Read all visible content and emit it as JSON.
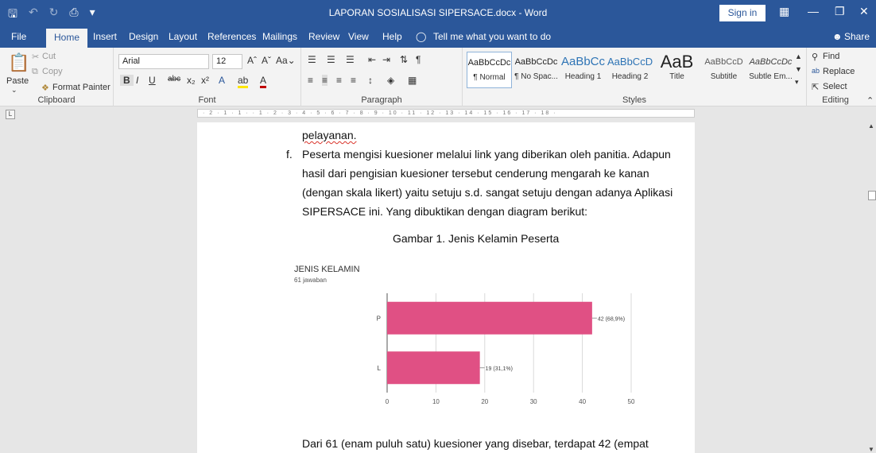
{
  "window": {
    "title": "LAPORAN SOSIALISASI SIPERSACE.docx  -  Word",
    "sign_in": "Sign in",
    "share": "Share"
  },
  "menu": {
    "tabs": [
      "File",
      "Home",
      "Insert",
      "Design",
      "Layout",
      "References",
      "Mailings",
      "Review",
      "View",
      "Help"
    ],
    "tell_me": "Tell me what you want to do"
  },
  "ribbon": {
    "clipboard": {
      "label": "Clipboard",
      "paste": "Paste",
      "cut": "Cut",
      "copy": "Copy",
      "format_painter": "Format Painter"
    },
    "font": {
      "label": "Font",
      "family": "Arial",
      "size": "12"
    },
    "paragraph": {
      "label": "Paragraph"
    },
    "styles": {
      "label": "Styles",
      "items": [
        {
          "preview": "AaBbCcDc",
          "name": "¶ Normal"
        },
        {
          "preview": "AaBbCcDc",
          "name": "¶ No Spac..."
        },
        {
          "preview": "AaBbCc",
          "name": "Heading 1"
        },
        {
          "preview": "AaBbCcD",
          "name": "Heading 2"
        },
        {
          "preview": "AaB",
          "name": "Title"
        },
        {
          "preview": "AaBbCcD",
          "name": "Subtitle"
        },
        {
          "preview": "AaBbCcDc",
          "name": "Subtle Em..."
        }
      ]
    },
    "editing": {
      "label": "Editing",
      "find": "Find",
      "replace": "Replace",
      "select": "Select"
    }
  },
  "document": {
    "line0": "pelayanan.",
    "item_marker": "f.",
    "para_lines": [
      "Peserta mengisi kuesioner melalui link yang diberikan oleh panitia. Adapun",
      "hasil dari pengisian kuesioner tersebut cenderung mengarah ke kanan",
      "(dengan skala likert) yaitu setuju s.d. sangat setuju dengan adanya Aplikasi",
      "SIPERSACE ini. Yang dibuktikan dengan diagram berikut:"
    ],
    "caption": "Gambar 1. Jenis Kelamin Peserta",
    "bottom_line": "Dari 61 (enam puluh satu) kuesioner yang disebar, terdapat 42 (empat"
  },
  "chart_data": {
    "type": "bar",
    "orientation": "horizontal",
    "title": "JENIS KELAMIN",
    "subtitle": "61 jawaban",
    "categories": [
      "P",
      "L"
    ],
    "values": [
      42,
      19
    ],
    "data_labels": [
      "42 (68,9%)",
      "19 (31,1%)"
    ],
    "xlim": [
      0,
      50
    ],
    "xticks": [
      0,
      10,
      20,
      30,
      40,
      50
    ],
    "grid": true,
    "bar_color": "#e05084"
  }
}
